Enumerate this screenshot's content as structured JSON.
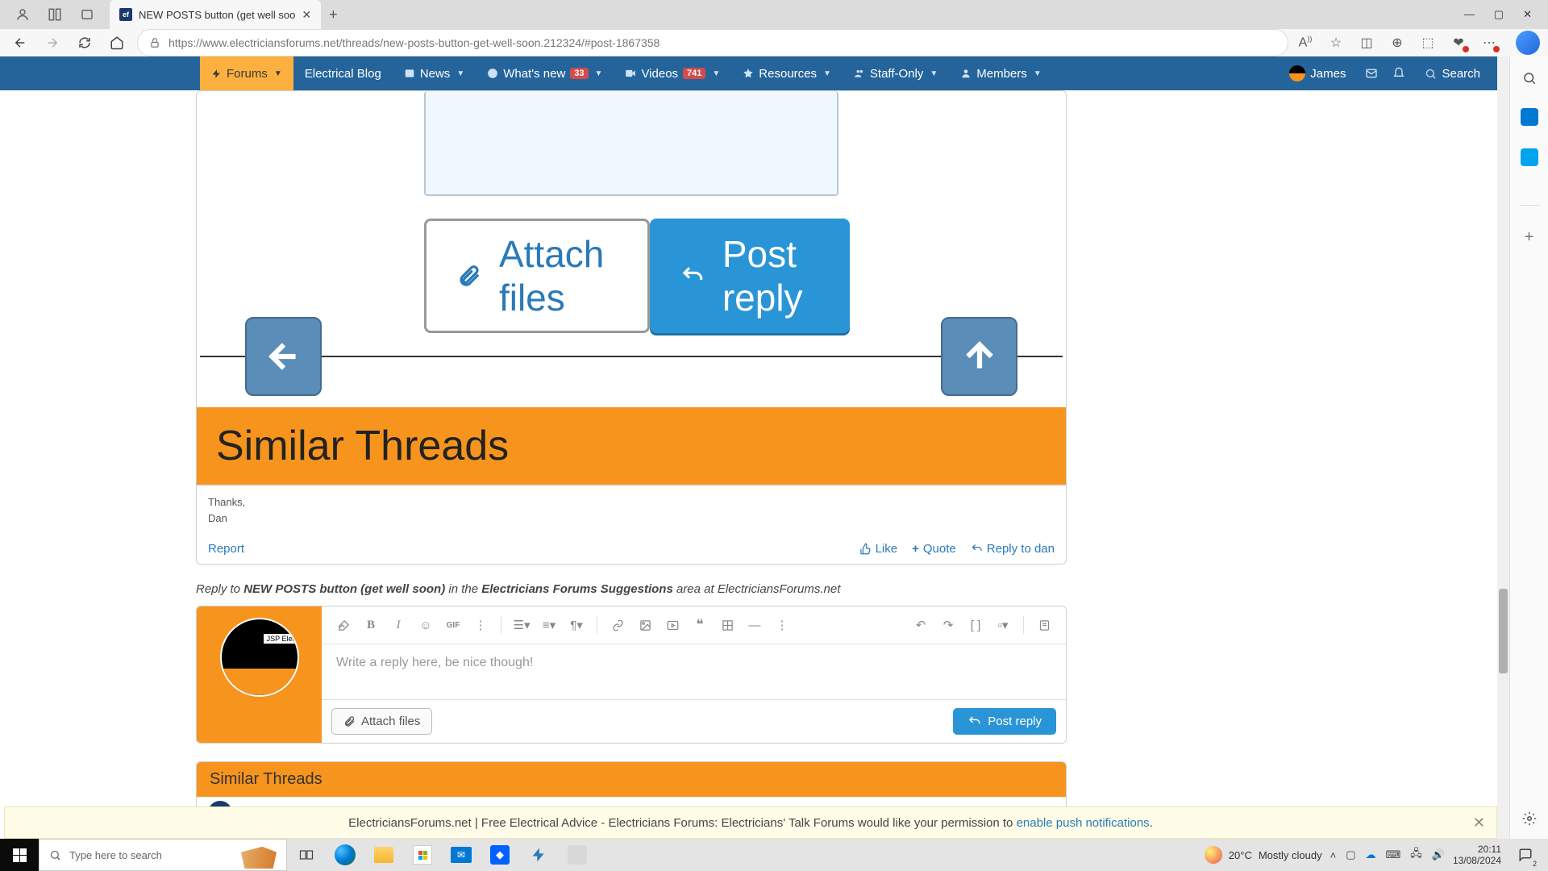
{
  "browser": {
    "tab_title": "NEW POSTS button (get well soo",
    "url": "https://www.electriciansforums.net/threads/new-posts-button-get-well-soon.212324/#post-1867358"
  },
  "nav": {
    "forums": "Forums",
    "electrical_blog": "Electrical Blog",
    "news": "News",
    "whats_new": "What's new",
    "whats_new_badge": "33",
    "videos": "Videos",
    "videos_badge": "741",
    "resources": "Resources",
    "staff_only": "Staff-Only",
    "members": "Members",
    "user": "James",
    "search": "Search"
  },
  "shot": {
    "attach": "Attach files",
    "post": "Post reply",
    "similar": "Similar Threads"
  },
  "signature": {
    "line1": "Thanks,",
    "line2": "Dan"
  },
  "actions": {
    "report": "Report",
    "like": "Like",
    "quote": "Quote",
    "reply": "Reply to dan"
  },
  "reply_prompt": {
    "p1": "Reply to ",
    "p2": "NEW POSTS button (get well soon)",
    "p3": " in the ",
    "p4": "Electricians Forums Suggestions",
    "p5": " area at ElectriciansForums.net"
  },
  "reply": {
    "avatar_label": "JSP Electri",
    "placeholder": "Write a reply here, be nice though!",
    "attach": "Attach files",
    "post": "Post reply"
  },
  "similar": {
    "header": "Similar Threads"
  },
  "notification": {
    "text_pre": "ElectriciansForums.net | Free Electrical Advice - Electricians Forums: Electricians' Talk Forums would like your permission to ",
    "link": "enable push notifications",
    "text_post": "."
  },
  "taskbar": {
    "search_placeholder": "Type here to search",
    "weather_temp": "20°C",
    "weather_desc": "Mostly cloudy",
    "time": "20:11",
    "date": "13/08/2024"
  }
}
